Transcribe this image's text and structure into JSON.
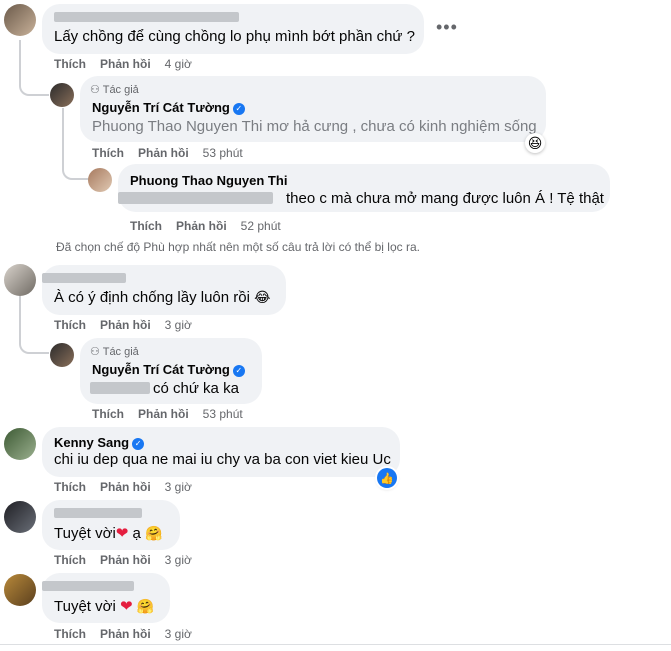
{
  "labels": {
    "like": "Thích",
    "reply": "Phản hồi",
    "author_tag": "Tác giả"
  },
  "more_icon": "•••",
  "comments": [
    {
      "text": "Lấy chồng để cùng chồng lo phụ mình bớt phần chứ ?",
      "time": "4 giờ"
    },
    {
      "name": "Nguyễn Trí Cát Tường",
      "text": "Phuong Thao Nguyen Thi mơ hả cưng , chưa có kinh nghiệm sống",
      "time": "53 phút",
      "reaction": "haha"
    },
    {
      "name": "Phuong Thao Nguyen Thi",
      "text": "theo c mà chưa mở mang được luôn Á ! Tệ thật",
      "time": "52 phút"
    },
    {
      "text": "À có ý định chống lầy luôn rồi",
      "time": "3 giờ"
    },
    {
      "name": "Nguyễn Trí Cát Tường",
      "text": "có chứ ka ka",
      "time": "53 phút"
    },
    {
      "name": "Kenny Sang",
      "text": "chi iu dep qua ne mai iu chy va ba con viet kieu Uc",
      "time": "3 giờ",
      "reaction": "like"
    },
    {
      "text": "Tuyệt vời",
      "text2": "ạ",
      "time": "3 giờ"
    },
    {
      "text": "Tuyệt vời",
      "time": "3 giờ"
    }
  ],
  "notice": "Đã chọn chế độ Phù hợp nhất nên một số câu trả lời có thể bị lọc ra."
}
